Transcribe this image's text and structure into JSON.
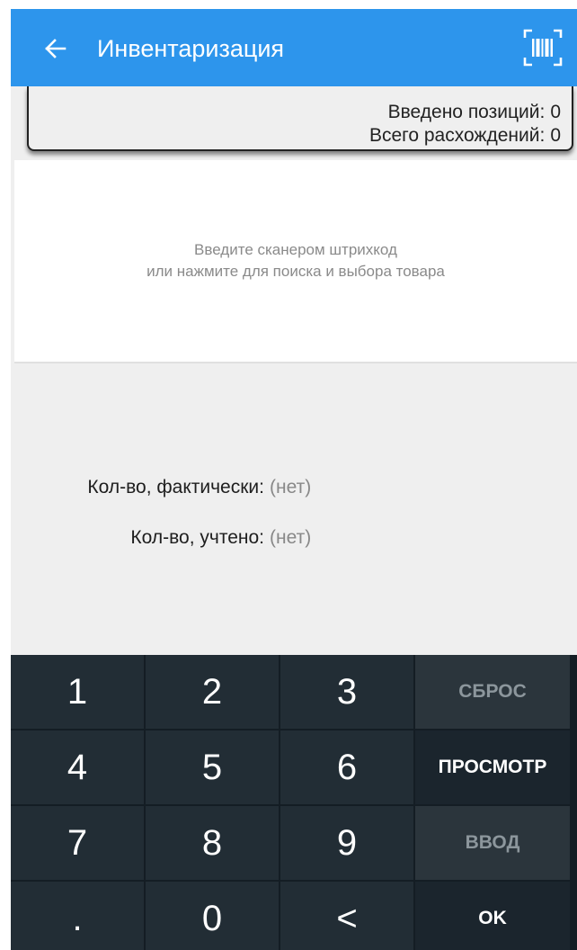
{
  "app_bar": {
    "title": "Инвентаризация",
    "back_icon": "arrow-left-icon",
    "scan_icon": "barcode-scan-icon",
    "color": "#2d95ec"
  },
  "summary": {
    "positions_label": "Введено позиций:",
    "positions_value": "0",
    "discrepancies_label": "Всего расхождений:",
    "discrepancies_value": "0"
  },
  "search": {
    "hint_line1": "Введите сканером штрихкод",
    "hint_line2": "или нажмите для поиска и выбора товара"
  },
  "quantities": {
    "actual_label": "Кол-во, фактически:",
    "actual_value": "(нет)",
    "counted_label": "Кол-во, учтено:",
    "counted_value": "(нет)"
  },
  "keypad": {
    "digits": [
      "1",
      "2",
      "3",
      "4",
      "5",
      "6",
      "7",
      "8",
      "9",
      ".",
      "0",
      "<"
    ],
    "reset_label": "СБРОС",
    "view_label": "ПРОСМОТР",
    "enter_label": "ВВОД",
    "ok_label": "OK"
  }
}
